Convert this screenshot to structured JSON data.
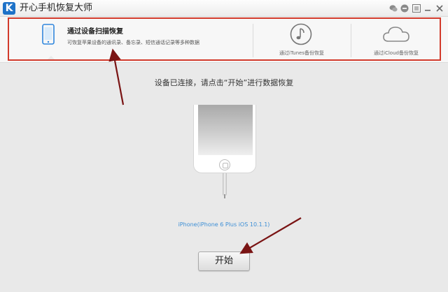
{
  "window": {
    "logo_letter": "K",
    "title": "开心手机恢复大师",
    "controls": [
      "wechat-icon",
      "chat-icon",
      "menu-icon",
      "minimize-icon",
      "close-icon"
    ]
  },
  "nav": {
    "tabs": [
      {
        "icon": "phone-icon",
        "title": "通过设备扫描恢复",
        "description": "可恢复苹果设备的通讯录、备忘录、短信通话记录等多种数据",
        "selected": true
      },
      {
        "icon": "music-note-icon",
        "label": "通过iTunes备份恢复",
        "selected": false
      },
      {
        "icon": "cloud-icon",
        "label": "通过iCloud备份恢复",
        "selected": false
      }
    ]
  },
  "main": {
    "status": "设备已连接，请点击“开始”进行数据恢复",
    "device_name": "iPhone(iPhone 6 Plus iOS 10.1.1)",
    "start_label": "开始"
  },
  "colors": {
    "highlight": "#d23a2b",
    "arrow": "#7a1414",
    "link_blue": "#3d8fd6",
    "accent_blue": "#1e72c8"
  }
}
